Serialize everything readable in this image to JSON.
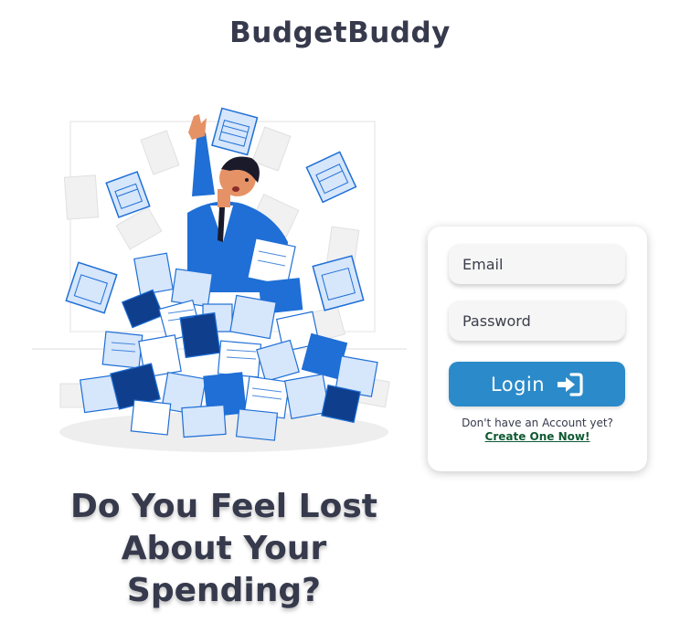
{
  "brand": {
    "name": "BudgetBuddy"
  },
  "hero": {
    "headline_lines": [
      "Do You Feel Lost",
      "About Your",
      "Spending?"
    ]
  },
  "login_form": {
    "email_placeholder": "Email",
    "password_placeholder": "Password",
    "login_label": "Login",
    "signup_prompt": "Don't have an Account yet?",
    "signup_link": "Create One Now!"
  },
  "colors": {
    "accent": "#2b8ac9",
    "text": "#363a4c",
    "link": "#0f5a33",
    "illustration_blue": "#1f6fd6",
    "illustration_dark": "#0f3e8c",
    "illustration_light": "#d6e6fb"
  },
  "icons": [
    "sign-in-icon"
  ]
}
